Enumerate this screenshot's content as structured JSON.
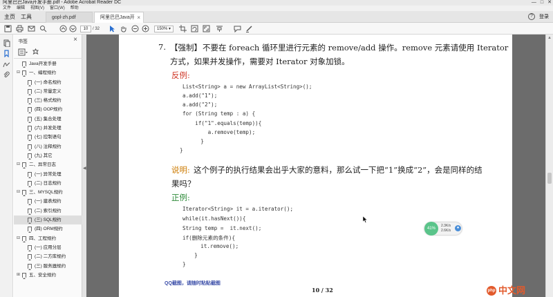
{
  "window": {
    "title": "阿里巴巴Java开发手册.pdf - Adobe Acrobat Reader DC",
    "controls": [
      "—",
      "□",
      "✕"
    ]
  },
  "menu": [
    "文件",
    "编辑",
    "视图(V)",
    "窗口(W)",
    "帮助"
  ],
  "tabs": {
    "home": "主页",
    "tools": "工具",
    "docs": [
      {
        "label": "gopl-zh.pdf",
        "active": false
      },
      {
        "label": "阿里巴巴Java开发...",
        "active": true
      }
    ],
    "help": "?",
    "login": "登录"
  },
  "toolbar": {
    "current_page": "10",
    "total_pages": "/ 32",
    "zoom": "150%"
  },
  "bookmarks": {
    "title": "书签",
    "items": [
      {
        "label": "Java开发手册",
        "level": 0,
        "toggle": ""
      },
      {
        "label": "一、编程规约",
        "level": 0,
        "toggle": "⊟"
      },
      {
        "label": "(一) 命名规约",
        "level": 1,
        "toggle": ""
      },
      {
        "label": "(二) 常量定义",
        "level": 1,
        "toggle": ""
      },
      {
        "label": "(三) 格式规约",
        "level": 1,
        "toggle": ""
      },
      {
        "label": "(四) OOP规约",
        "level": 1,
        "toggle": ""
      },
      {
        "label": "(五) 集合处理",
        "level": 1,
        "toggle": ""
      },
      {
        "label": "(六) 并发处理",
        "level": 1,
        "toggle": ""
      },
      {
        "label": "(七) 控制语句",
        "level": 1,
        "toggle": ""
      },
      {
        "label": "(八) 注释规约",
        "level": 1,
        "toggle": ""
      },
      {
        "label": "(九) 其它",
        "level": 1,
        "toggle": ""
      },
      {
        "label": "二、异常日志",
        "level": 0,
        "toggle": "⊟"
      },
      {
        "label": "(一) 异常处理",
        "level": 1,
        "toggle": ""
      },
      {
        "label": "(二) 日志规约",
        "level": 1,
        "toggle": ""
      },
      {
        "label": "三、MYSQL规约",
        "level": 0,
        "toggle": "⊟"
      },
      {
        "label": "(一) 建表规约",
        "level": 1,
        "toggle": ""
      },
      {
        "label": "(二) 索引规约",
        "level": 1,
        "toggle": ""
      },
      {
        "label": "(三) SQL规约",
        "level": 1,
        "toggle": "",
        "selected": true
      },
      {
        "label": "(四) ORM规约",
        "level": 1,
        "toggle": ""
      },
      {
        "label": "四、工程规约",
        "level": 0,
        "toggle": "⊟"
      },
      {
        "label": "(一) 应用分层",
        "level": 1,
        "toggle": ""
      },
      {
        "label": "(二) 二方库规约",
        "level": 1,
        "toggle": ""
      },
      {
        "label": "(三) 服务器规约",
        "level": 1,
        "toggle": ""
      },
      {
        "label": "五、安全规约",
        "level": 0,
        "toggle": "⊞"
      }
    ]
  },
  "page": {
    "rule_number": "7.",
    "rule_tag": "【强制】",
    "rule_line1": "不要在 foreach 循环里进行元素的 remove/add 操作。remove 元素请使用 Iterator",
    "rule_line2": "方式，如果并发操作，需要对 Iterator 对象加锁。",
    "counter_label": "反例:",
    "counter_code": [
      "List<String> a = new ArrayList<String>();",
      "a.add(\"1\");",
      "a.add(\"2\");",
      "for (String temp : a) {",
      "    if(\"1\".equals(temp)){",
      "        a.remove(temp);",
      "    }",
      "}"
    ],
    "note_label": "说明:",
    "note_line1": "这个例子的执行结果会出乎大家的意料，那么试一下把“1”换成“2”，会是同样的结",
    "note_line2": "果吗？",
    "good_label": "正例:",
    "good_code": [
      "Iterator<String> it = a.iterator();",
      "while(it.hasNext()){",
      "String temp =  it.next();",
      "if(删除元素的条件){",
      "    it.remove();",
      "  }",
      "}"
    ],
    "footer": "10 / 32"
  },
  "overlay": {
    "percent": "41%",
    "up": "2.3K/s",
    "down": "2.6K/s"
  },
  "watermark": "QQ截图，请随时粘贴截图",
  "brand": {
    "mark": "php",
    "text": "中文网"
  }
}
